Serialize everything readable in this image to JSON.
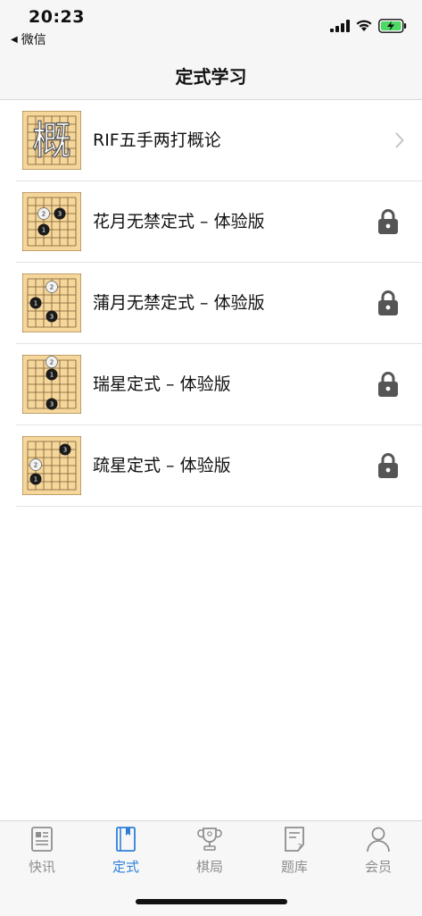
{
  "status_bar": {
    "time": "20:23",
    "back_app": "微信"
  },
  "nav": {
    "title": "定式学习"
  },
  "items": [
    {
      "label": "RIF五手两打概论",
      "thumb_char": "概",
      "accessory": "chevron"
    },
    {
      "label": "花月无禁定式 – 体验版",
      "accessory": "lock"
    },
    {
      "label": "蒲月无禁定式 – 体验版",
      "accessory": "lock"
    },
    {
      "label": "瑞星定式 – 体验版",
      "accessory": "lock"
    },
    {
      "label": "疏星定式 – 体验版",
      "accessory": "lock"
    }
  ],
  "tabs": [
    {
      "label": "快讯",
      "icon": "newspaper-icon"
    },
    {
      "label": "定式",
      "icon": "book-icon",
      "active": true
    },
    {
      "label": "棋局",
      "icon": "trophy-icon"
    },
    {
      "label": "题库",
      "icon": "question-doc-icon"
    },
    {
      "label": "会员",
      "icon": "person-icon"
    }
  ],
  "colors": {
    "accent": "#2f7fd8",
    "board": "#f5d69b",
    "inactive": "#8e8e8e"
  }
}
